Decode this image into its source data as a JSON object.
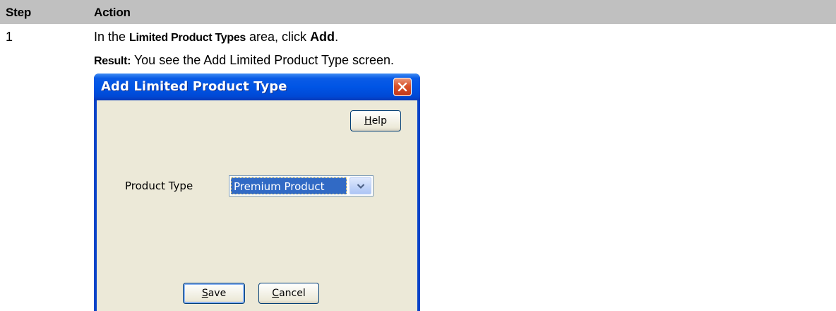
{
  "table": {
    "header": {
      "step": "Step",
      "action": "Action"
    },
    "row": {
      "step": "1",
      "line1": {
        "prefix": "In the ",
        "bold1": "Limited Product Types",
        "mid": " area, click ",
        "bold2": "Add",
        "suffix": "."
      },
      "line2": {
        "label": "Result:",
        "text": " You see the Add Limited Product Type screen."
      }
    }
  },
  "dialog": {
    "title": "Add Limited Product Type",
    "help_button": {
      "mnemonic": "H",
      "rest": "elp"
    },
    "field_label": "Product Type",
    "product_type_value": "Premium Product",
    "save_button": {
      "mnemonic": "S",
      "rest": "ave"
    },
    "cancel_button": {
      "mnemonic": "C",
      "rest": "ancel"
    },
    "title_bar_color": "#0055e5",
    "selection_color": "#316ac5",
    "icons": {
      "close": "close-icon",
      "dropdown": "chevron-down-icon"
    }
  }
}
